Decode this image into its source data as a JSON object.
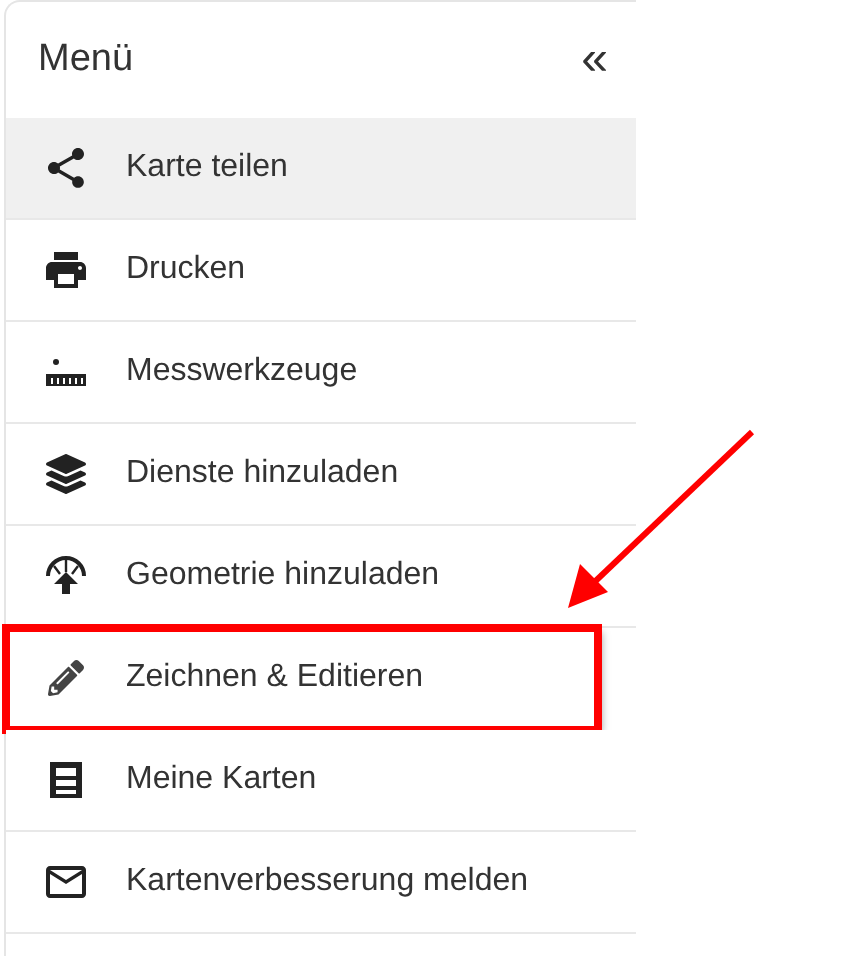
{
  "menu": {
    "title": "Menü",
    "collapse": "«",
    "items": [
      {
        "label": "Karte teilen",
        "hovered": true,
        "marked": false
      },
      {
        "label": "Drucken",
        "hovered": false,
        "marked": false
      },
      {
        "label": "Messwerkzeuge",
        "hovered": false,
        "marked": false
      },
      {
        "label": "Dienste hinzuladen",
        "hovered": false,
        "marked": false
      },
      {
        "label": "Geometrie hinzuladen",
        "hovered": false,
        "marked": false
      },
      {
        "label": "Zeichnen & Editieren",
        "hovered": false,
        "marked": true
      },
      {
        "label": "Meine Karten",
        "hovered": false,
        "marked": false
      },
      {
        "label": "Kartenverbesserung melden",
        "hovered": false,
        "marked": false
      }
    ]
  }
}
